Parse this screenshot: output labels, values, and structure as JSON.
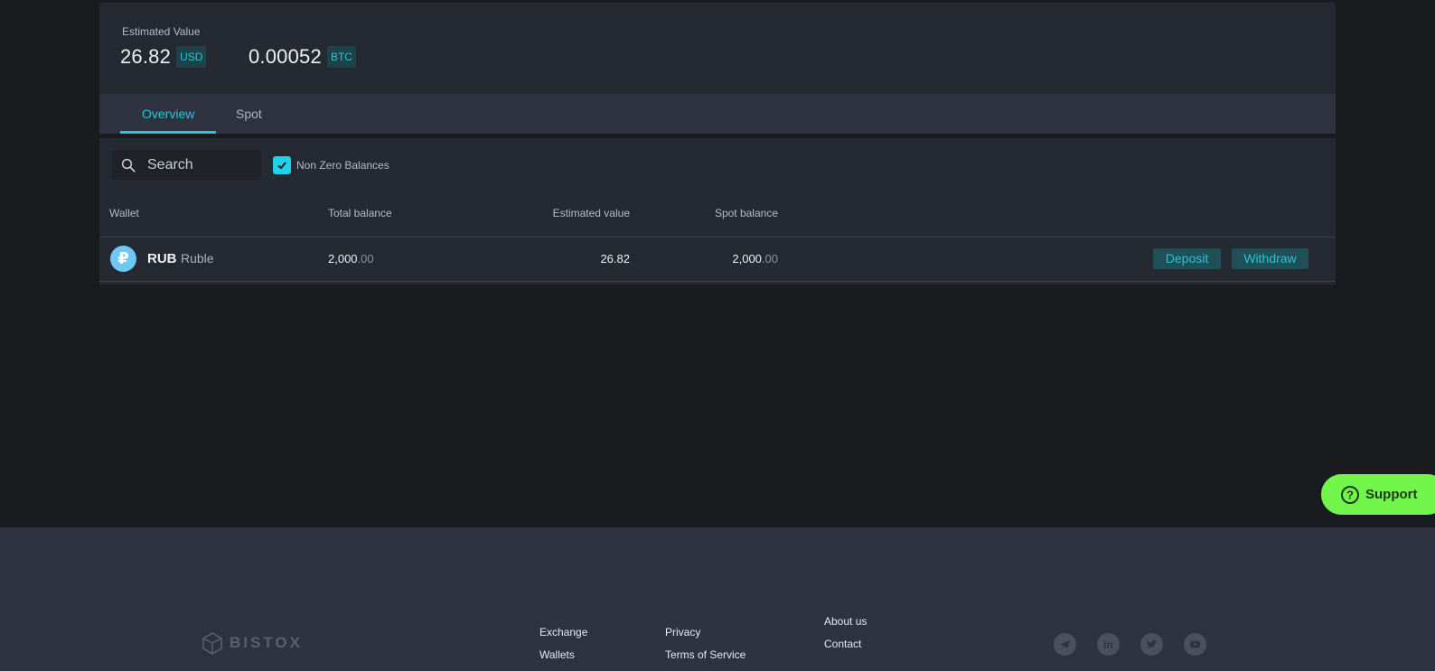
{
  "estimated": {
    "label": "Estimated Value",
    "usd_value": "26.82",
    "usd_currency": "USD",
    "btc_value": "0.00052",
    "btc_currency": "BTC"
  },
  "tabs": [
    {
      "label": "Overview",
      "active": true
    },
    {
      "label": "Spot",
      "active": false
    }
  ],
  "filters": {
    "search_placeholder": "Search",
    "non_zero_label": "Non Zero Balances",
    "non_zero_checked": true
  },
  "table": {
    "headers": [
      "Wallet",
      "Total balance",
      "Estimated value",
      "Spot balance"
    ],
    "rows": [
      {
        "icon_glyph": "₽",
        "symbol": "RUB",
        "name": "Ruble",
        "total_main": "2,000",
        "total_dec": ".00",
        "estimated": "26.82",
        "spot_main": "2,000",
        "spot_dec": ".00",
        "deposit_label": "Deposit",
        "withdraw_label": "Withdraw"
      }
    ]
  },
  "support": {
    "label": "Support",
    "icon": "question-circle-icon",
    "color": "#71f54a"
  },
  "footer": {
    "logo_text": "BISTOX",
    "col1": [
      "Exchange",
      "Wallets"
    ],
    "col2": [
      "Privacy",
      "Terms of Service"
    ],
    "col3": [
      "About us",
      "Contact"
    ],
    "social_icons": [
      "telegram-icon",
      "linkedin-icon",
      "twitter-icon",
      "youtube-icon"
    ]
  },
  "colors": {
    "accent": "#27c6dc",
    "background": "#1a1b1e",
    "panel": "#252932"
  }
}
